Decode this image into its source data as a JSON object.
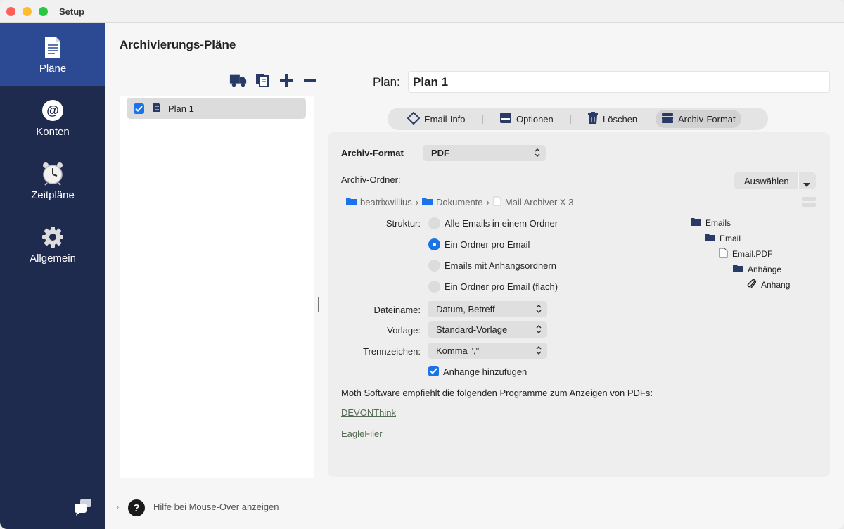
{
  "window": {
    "title": "Setup"
  },
  "sidebar": {
    "items": [
      {
        "label": "Pläne",
        "icon": "document-icon",
        "active": true
      },
      {
        "label": "Konten",
        "icon": "at-icon",
        "active": false
      },
      {
        "label": "Zeitpläne",
        "icon": "alarm-clock-icon",
        "active": false
      },
      {
        "label": "Allgemein",
        "icon": "gear-icon",
        "active": false
      }
    ]
  },
  "page": {
    "title": "Archivierungs-Pläne"
  },
  "plans": {
    "items": [
      {
        "label": "Plan 1",
        "checked": true
      }
    ]
  },
  "plan_field": {
    "label": "Plan:",
    "value": "Plan 1"
  },
  "tabs": [
    {
      "label": "Email-Info",
      "icon": "diamond-icon"
    },
    {
      "label": "Optionen",
      "icon": "drive-icon"
    },
    {
      "label": "Löschen",
      "icon": "trash-icon"
    },
    {
      "label": "Archiv-Format",
      "icon": "stack-icon",
      "active": true
    }
  ],
  "format": {
    "label": "Archiv-Format",
    "value": "PDF",
    "folder_label": "Archiv-Ordner:",
    "choose_button": "Auswählen",
    "path": [
      "beatrixwillius",
      "Dokumente",
      "Mail Archiver X 3"
    ],
    "structure_label": "Struktur:",
    "structure_options": [
      {
        "label": "Alle Emails in einem Ordner",
        "selected": false
      },
      {
        "label": "Ein Ordner pro Email",
        "selected": true
      },
      {
        "label": "Emails mit Anhangsordnern",
        "selected": false
      },
      {
        "label": "Ein Ordner pro Email (flach)",
        "selected": false
      }
    ],
    "filename_label": "Dateiname:",
    "filename_value": "Datum, Betreff",
    "template_label": "Vorlage:",
    "template_value": "Standard-Vorlage",
    "separator_label": "Trennzeichen:",
    "separator_value": "Komma \",\"",
    "attachments_label": "Anhänge hinzufügen",
    "attachments_checked": true,
    "recommend_text": "Moth Software empfiehlt die folgenden Programme zum Anzeigen von PDFs:",
    "links": [
      "DEVONThink",
      "EagleFiler"
    ],
    "tree": [
      "Emails",
      "Email",
      "Email.PDF",
      "Anhänge",
      "Anhang"
    ]
  },
  "footer": {
    "help_text": "Hilfe bei Mouse-Over anzeigen"
  },
  "colors": {
    "sidebar": "#1f2a4f",
    "sidebar_active": "#2c4a94",
    "accent": "#1a73e8",
    "icon": "#2a3a66"
  }
}
